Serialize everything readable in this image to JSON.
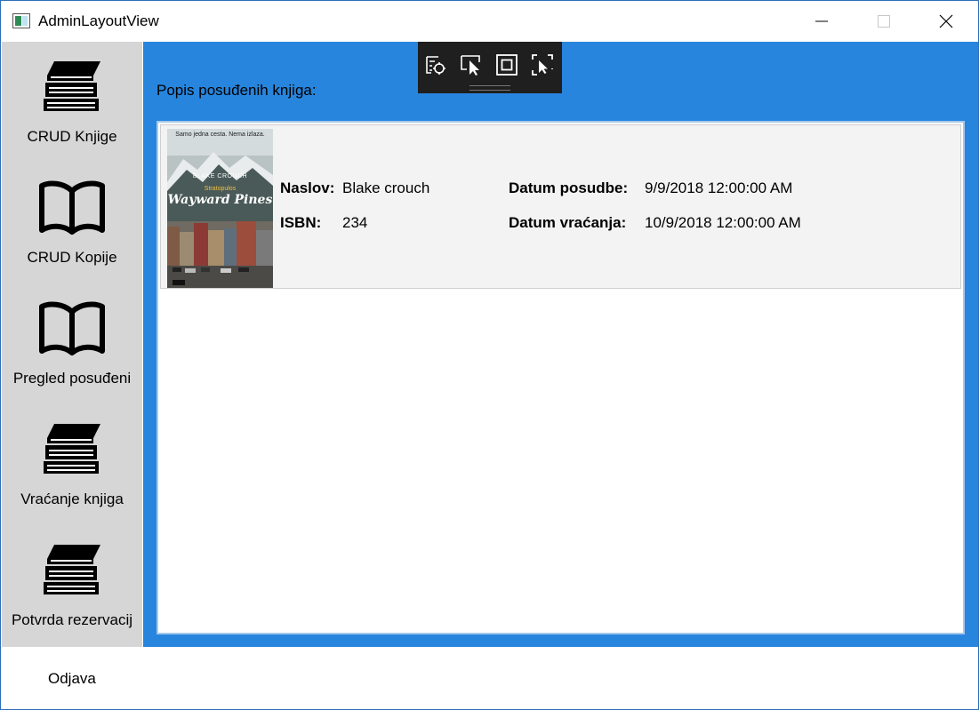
{
  "window": {
    "title": "AdminLayoutView",
    "minimize_icon": "minimize-icon",
    "maximize_icon": "maximize-icon",
    "close_icon": "close-icon"
  },
  "sidebar": {
    "items": [
      {
        "label": "CRUD Knjige",
        "icon": "books-stack-icon"
      },
      {
        "label": "CRUD Kopije",
        "icon": "open-book-icon"
      },
      {
        "label": "Pregled posuđeni",
        "icon": "open-book-icon"
      },
      {
        "label": "Vraćanje knjiga",
        "icon": "books-stack-icon"
      },
      {
        "label": "Potvrda rezervacij",
        "icon": "books-stack-icon"
      }
    ]
  },
  "debug_toolbar": {
    "icons": [
      "live-visual-tree-icon",
      "select-element-icon",
      "display-layout-adorners-icon",
      "track-focus-icon"
    ]
  },
  "main": {
    "heading": "Popis posuđenih knjiga:",
    "loans": [
      {
        "cover": {
          "tagline": "Samo jedna cesta. Nema izlaza.",
          "author": "BLAKE CROUCH",
          "series": "Stratopulos",
          "title": "Wayward Pines",
          "colors": {
            "sky": "#bfc8c8",
            "mountain": "#4a5a58",
            "street": "#6f6a62"
          }
        },
        "naslov_label": "Naslov:",
        "naslov_value": "Blake crouch",
        "isbn_label": "ISBN:",
        "isbn_value": "234",
        "datum_posudbe_label": "Datum posudbe:",
        "datum_posudbe_value": "9/9/2018 12:00:00 AM",
        "datum_vracanja_label": "Datum vraćanja:",
        "datum_vracanja_value": "10/9/2018 12:00:00 AM"
      }
    ]
  },
  "footer": {
    "logout_label": "Odjava"
  },
  "colors": {
    "accent": "#2785dd",
    "sidebar_bg": "#d6d6d6",
    "row_bg": "#f3f3f3",
    "toolbar_bg": "#1f1f1f"
  }
}
